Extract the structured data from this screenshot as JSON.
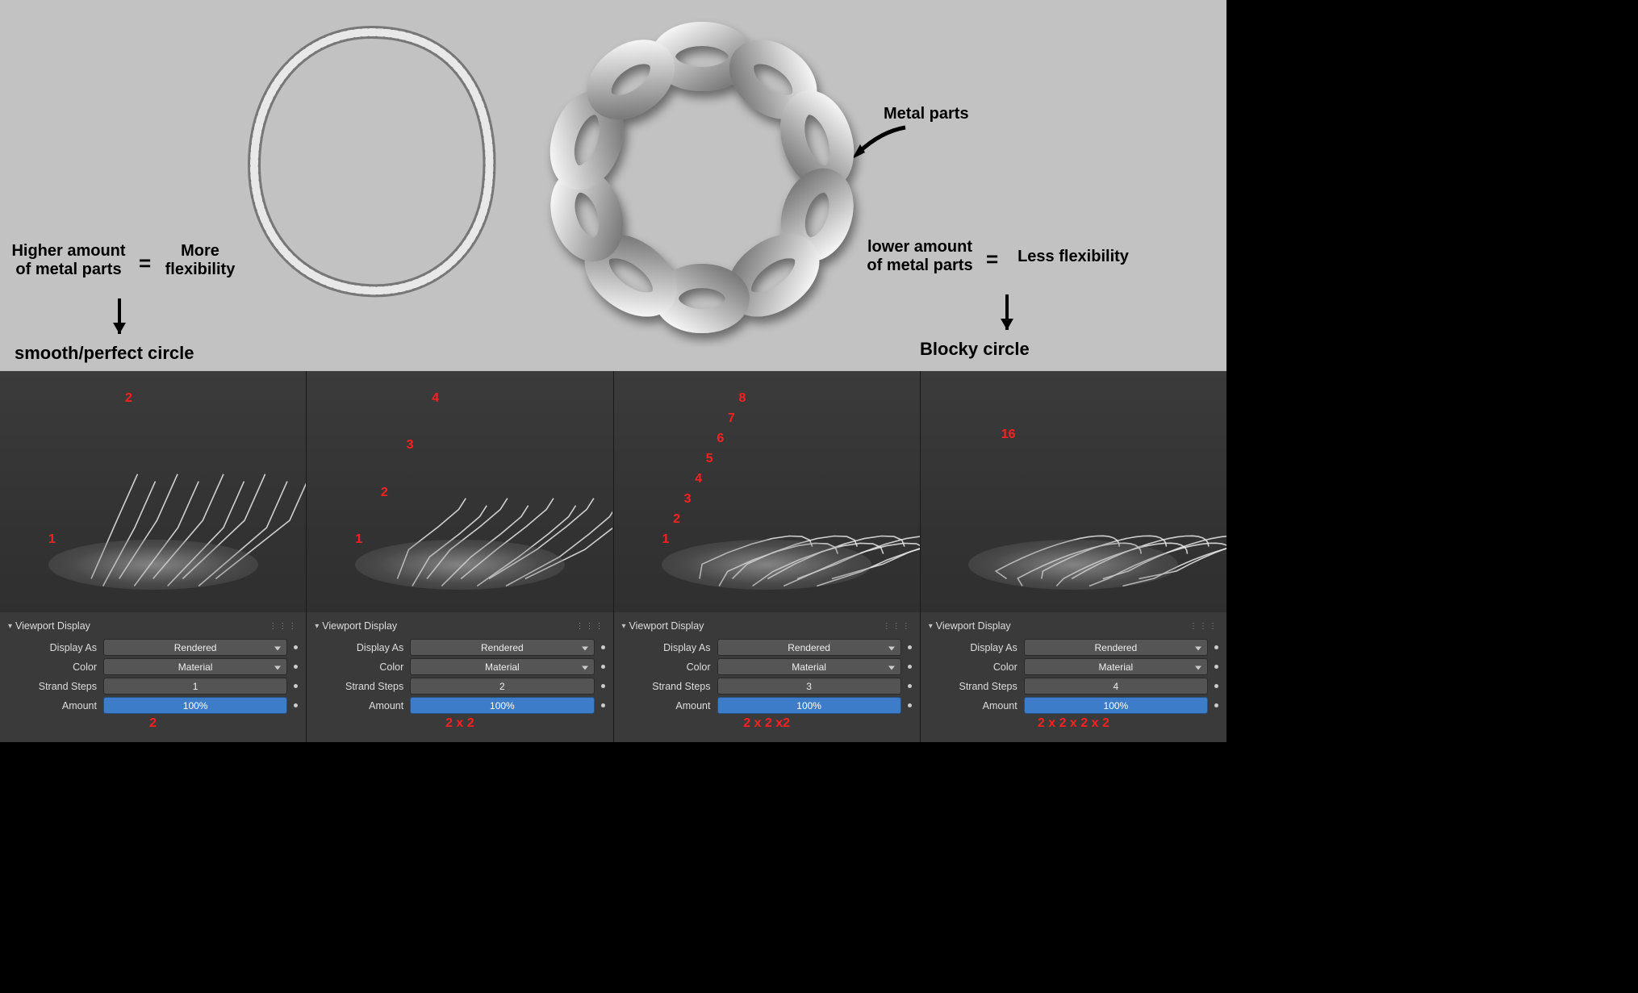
{
  "concept": {
    "left": {
      "l1": "Higher amount",
      "l2": "of metal parts",
      "eq": "=",
      "r": "More\nflexibility",
      "result": "smooth/perfect circle"
    },
    "right": {
      "l1": "lower amount",
      "l2": "of metal parts",
      "eq": "=",
      "r": "Less flexibility",
      "result": "Blocky circle"
    },
    "metal_parts_label": "Metal parts"
  },
  "panel_header": "Viewport Display",
  "labels": {
    "display_as": "Display As",
    "color": "Color",
    "strand_steps": "Strand Steps",
    "amount": "Amount"
  },
  "common": {
    "display_as_value": "Rendered",
    "color_value": "Material",
    "amount_value": "100%"
  },
  "panels": [
    {
      "strand_steps": "1",
      "segments": 2,
      "red_nums": [
        "1",
        "2"
      ],
      "formula": "2"
    },
    {
      "strand_steps": "2",
      "segments": 4,
      "red_nums": [
        "1",
        "2",
        "3",
        "4"
      ],
      "formula": "2 x 2"
    },
    {
      "strand_steps": "3",
      "segments": 8,
      "red_nums": [
        "1",
        "2",
        "3",
        "4",
        "5",
        "6",
        "7",
        "8"
      ],
      "formula": "2 x 2 x2"
    },
    {
      "strand_steps": "4",
      "segments": 16,
      "red_nums": [
        "16"
      ],
      "formula": "2 x 2 x 2 x 2"
    }
  ]
}
